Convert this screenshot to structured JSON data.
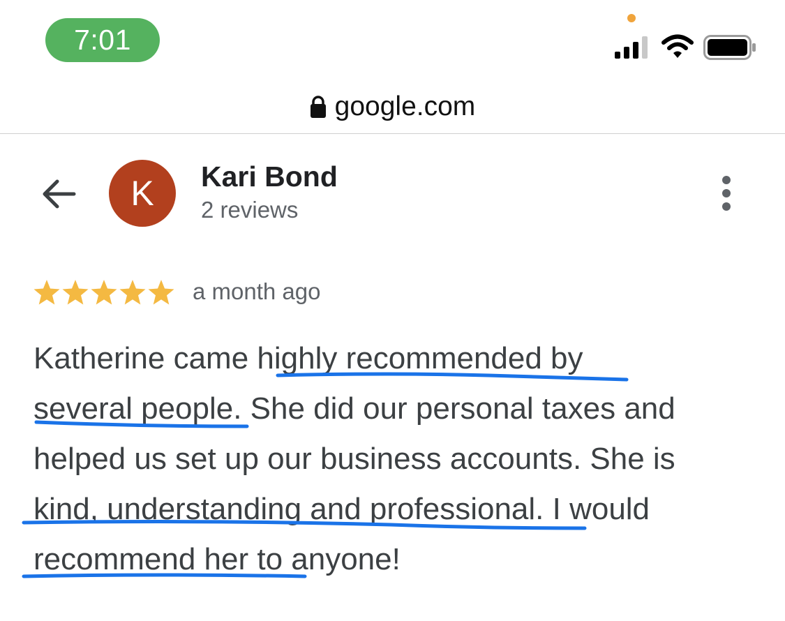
{
  "status_bar": {
    "time": "7:01",
    "privacy_dot_color": "#f0a43c",
    "icons": [
      "signal-icon",
      "wifi-icon",
      "battery-icon"
    ]
  },
  "browser": {
    "domain": "google.com",
    "icon": "lock-icon"
  },
  "reviewer": {
    "initial": "K",
    "name": "Kari Bond",
    "review_count": "2 reviews",
    "avatar_color": "#b2401e"
  },
  "review": {
    "rating": 5,
    "rating_max": 5,
    "time_ago": "a month ago",
    "lines": [
      "Katherine came highly recommended by",
      "several people. She did our personal taxes and",
      "helped us set up our business accounts. She is",
      "kind, understanding and professional. I would",
      "recommend her to anyone!"
    ]
  },
  "colors": {
    "star": "#f4b942",
    "underline_annotation": "#1a73e8",
    "time_pill": "#55b25f"
  }
}
